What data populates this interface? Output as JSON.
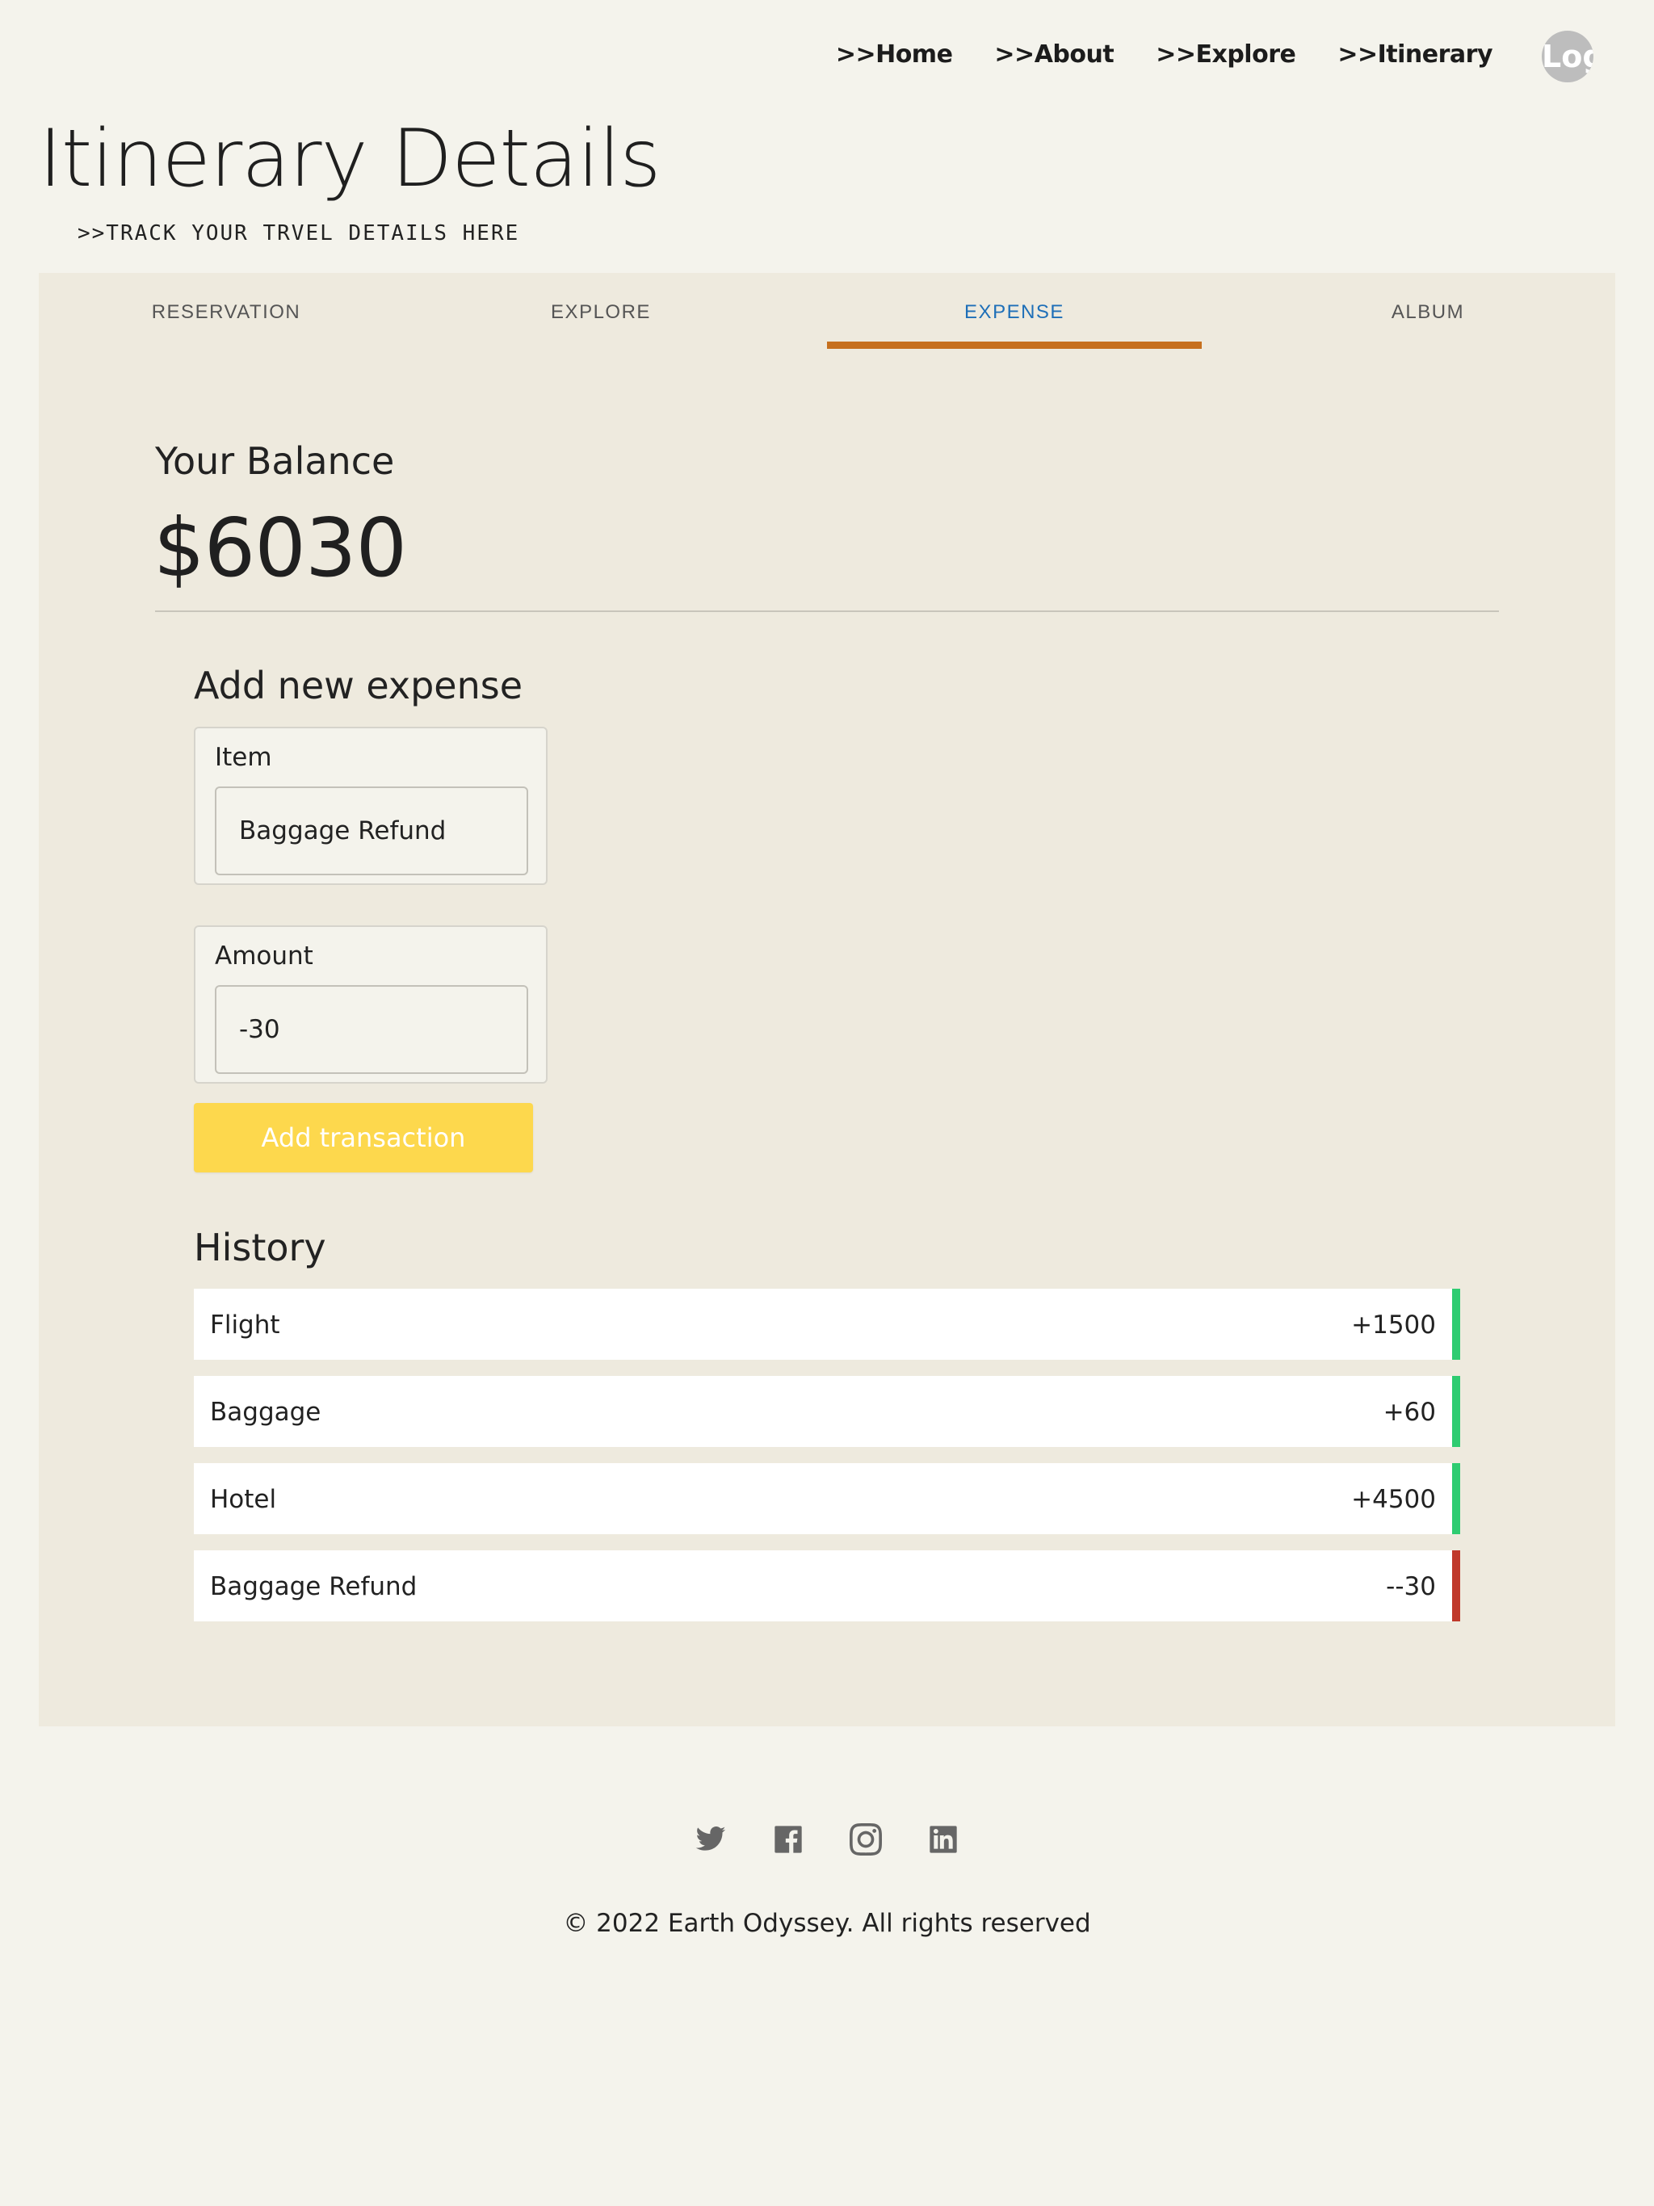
{
  "nav": {
    "links": [
      ">>Home",
      ">>About",
      ">>Explore",
      ">>Itinerary"
    ],
    "avatar_text": "Log"
  },
  "header": {
    "title": "Itinerary Details",
    "subtitle": ">>TRACK YOUR TRVEL DETAILS HERE"
  },
  "tabs": [
    {
      "label": "RESERVATION",
      "active": false
    },
    {
      "label": "EXPLORE",
      "active": false
    },
    {
      "label": "EXPENSE",
      "active": true
    },
    {
      "label": "ALBUM",
      "active": false
    }
  ],
  "balance": {
    "label": "Your Balance",
    "value": "$6030"
  },
  "form": {
    "heading": "Add new expense",
    "item_label": "Item",
    "item_value": "Baggage Refund",
    "amount_label": "Amount",
    "amount_value": "-30",
    "button_label": "Add transaction"
  },
  "history": {
    "heading": "History",
    "items": [
      {
        "name": "Flight",
        "amount": "+1500",
        "type": "plus"
      },
      {
        "name": "Baggage",
        "amount": "+60",
        "type": "plus"
      },
      {
        "name": "Hotel",
        "amount": "+4500",
        "type": "plus"
      },
      {
        "name": "Baggage Refund",
        "amount": "--30",
        "type": "minus"
      }
    ]
  },
  "colors": {
    "plus": "#2ecc71",
    "minus": "#c0392b",
    "active_tab": "#1e6fb8",
    "tab_underline": "#c6701e",
    "button": "#fdd84d"
  },
  "footer": {
    "icons": [
      "twitter-icon",
      "facebook-icon",
      "instagram-icon",
      "linkedin-icon"
    ],
    "copyright": "© 2022 Earth Odyssey. All rights reserved"
  }
}
